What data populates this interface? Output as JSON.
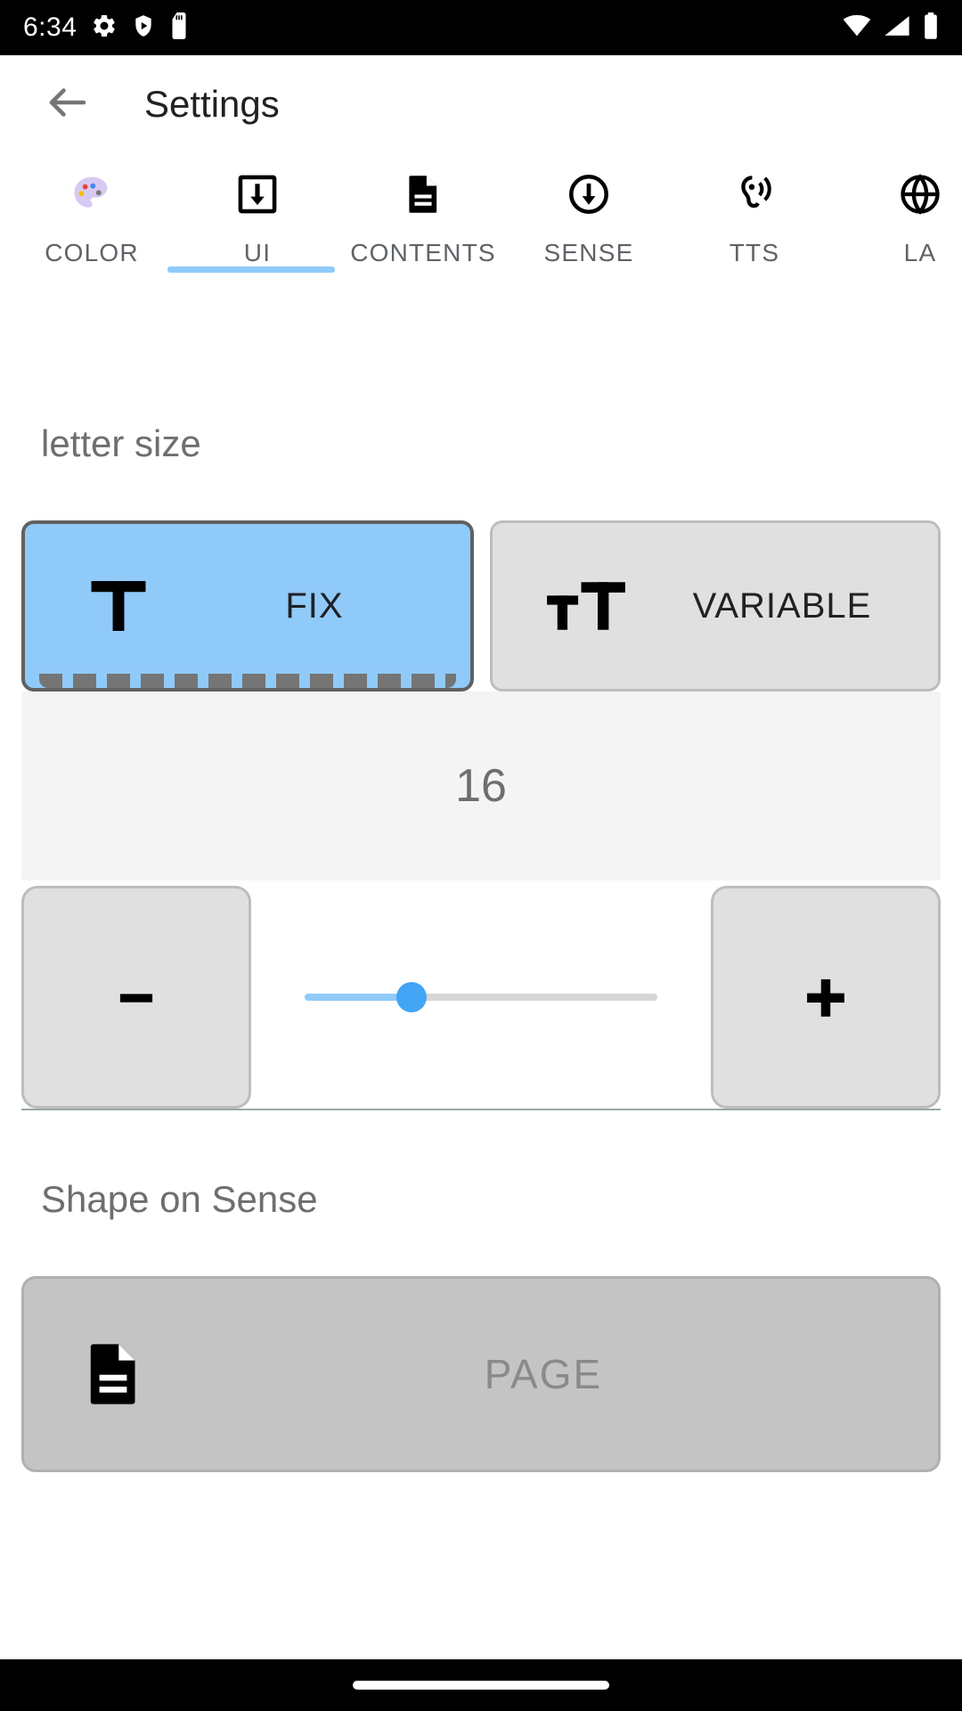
{
  "statusbar": {
    "time": "6:34",
    "left_icons": [
      "gear-icon",
      "shield-play-icon",
      "sd-card-icon"
    ],
    "right_icons": [
      "wifi-icon",
      "cellular-signal-icon",
      "battery-icon"
    ]
  },
  "appbar": {
    "back_icon": "back-arrow-icon",
    "title": "Settings"
  },
  "tabs": {
    "active_index": 1,
    "indicator_color": "#90caf9",
    "items": [
      {
        "label": "COLOR",
        "icon": "palette-icon"
      },
      {
        "label": "UI",
        "icon": "box-download-icon"
      },
      {
        "label": "CONTENTS",
        "icon": "document-lines-icon"
      },
      {
        "label": "SENSE",
        "icon": "circle-arrow-down-icon"
      },
      {
        "label": "TTS",
        "icon": "hearing-icon"
      },
      {
        "label": "LA",
        "icon": "language-icon"
      }
    ]
  },
  "letter_size": {
    "heading": "letter size",
    "options": [
      {
        "label": "FIX",
        "glyph": "T",
        "selected": true
      },
      {
        "label": "VARIABLE",
        "glyph": "TT",
        "selected": false
      }
    ],
    "value": "16",
    "minus_label": "–",
    "plus_label": "+",
    "slider": {
      "percent": 30
    },
    "accent": "#90caf9",
    "thumb_color": "#42a5f5"
  },
  "shape_on_sense": {
    "heading": "Shape on Sense",
    "options": [
      {
        "label": "PAGE",
        "icon": "document-icon"
      }
    ]
  },
  "navbar": {
    "handle": "home-gesture-pill"
  }
}
